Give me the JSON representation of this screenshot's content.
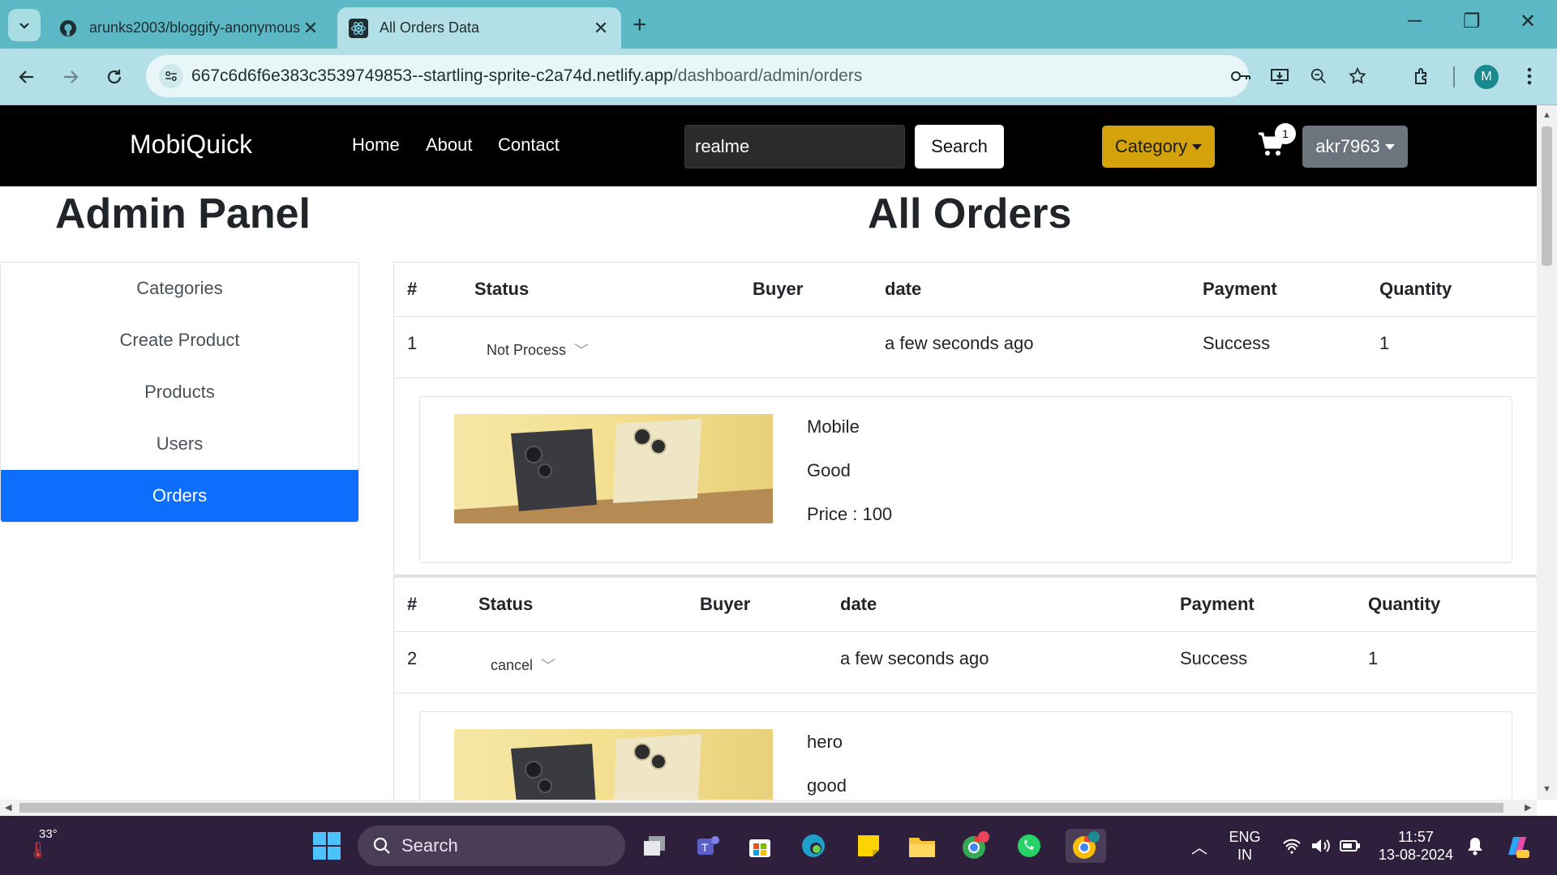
{
  "browser": {
    "tabs": [
      {
        "title": "arunks2003/bloggify-anonymous",
        "icon": "github-icon",
        "active": false
      },
      {
        "title": "All Orders Data",
        "icon": "react-icon",
        "active": true
      }
    ],
    "url_host": "667c6d6f6e383c3539749853--startling-sprite-c2a74d.netlify.app",
    "url_path": "/dashboard/admin/orders",
    "profile_initial": "M"
  },
  "site": {
    "brand": "MobiQuick",
    "nav": [
      "Home",
      "About",
      "Contact"
    ],
    "search_value": "realme",
    "search_button": "Search",
    "category_button": "Category",
    "cart_count": "1",
    "user_button": "akr7963"
  },
  "admin": {
    "title": "Admin Panel",
    "menu": [
      "Categories",
      "Create Product",
      "Products",
      "Users",
      "Orders"
    ],
    "active_menu": "Orders"
  },
  "page_title": "All Orders",
  "table_headers": {
    "num": "#",
    "status": "Status",
    "buyer": "Buyer",
    "date": "date",
    "payment": "Payment",
    "quantity": "Quantity"
  },
  "orders": [
    {
      "num": "1",
      "status": "Not Process",
      "buyer": "",
      "date": "a few seconds ago",
      "payment": "Success",
      "quantity": "1",
      "product": {
        "name": "Mobile",
        "description": "Good",
        "price": "Price : 100"
      }
    },
    {
      "num": "2",
      "status": "cancel",
      "buyer": "",
      "date": "a few seconds ago",
      "payment": "Success",
      "quantity": "1",
      "product": {
        "name": "hero",
        "description": "good",
        "price": ""
      }
    }
  ],
  "taskbar": {
    "weather_temp": "33°",
    "search_label": "Search",
    "lang_line1": "ENG",
    "lang_line2": "IN",
    "time": "11:57",
    "date": "13-08-2024"
  },
  "colors": {
    "accent": "#0d6efd",
    "category": "#d4a20a",
    "user": "#6c757d",
    "tabstrip": "#5bb8c4",
    "toolbar": "#b3e0e6"
  }
}
